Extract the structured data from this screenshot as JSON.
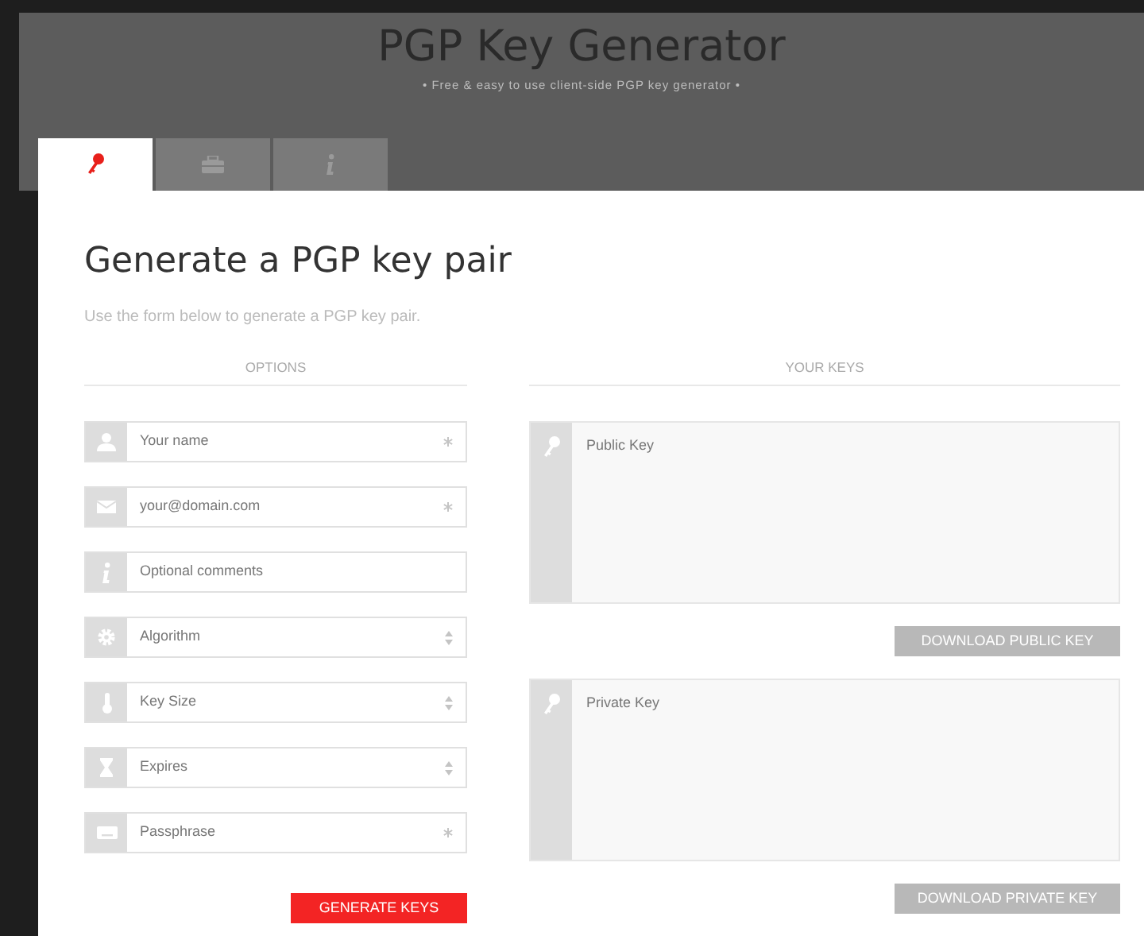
{
  "header": {
    "title": "PGP Key Generator",
    "tagline": "• Free & easy to use client-side PGP key generator •"
  },
  "tabs": [
    {
      "kind": "key",
      "selected": true
    },
    {
      "kind": "box",
      "selected": false
    },
    {
      "kind": "info",
      "selected": false
    }
  ],
  "heading": "Generate a PGP key pair",
  "intro": "Use the form below to generate a PGP key pair.",
  "options": {
    "title": "OPTIONS",
    "fields": [
      {
        "kind": "input",
        "placeholder": "Your name",
        "required": true
      },
      {
        "kind": "input",
        "placeholder": "your@domain.com",
        "required": true
      },
      {
        "kind": "input",
        "placeholder": "Optional comments",
        "required": false
      },
      {
        "kind": "select",
        "value": "Algorithm"
      },
      {
        "kind": "select",
        "value": "Key Size"
      },
      {
        "kind": "select",
        "value": "Expires"
      },
      {
        "kind": "input",
        "placeholder": "Passphrase",
        "required": true
      }
    ],
    "button": "GENERATE KEYS"
  },
  "keys": {
    "title": "YOUR KEYS",
    "boxes": [
      {
        "placeholder": "Public Key",
        "button": "DOWNLOAD PUBLIC KEY",
        "disabled": true
      },
      {
        "placeholder": "Private Key",
        "button": "DOWNLOAD PRIVATE KEY",
        "disabled": true
      }
    ]
  }
}
